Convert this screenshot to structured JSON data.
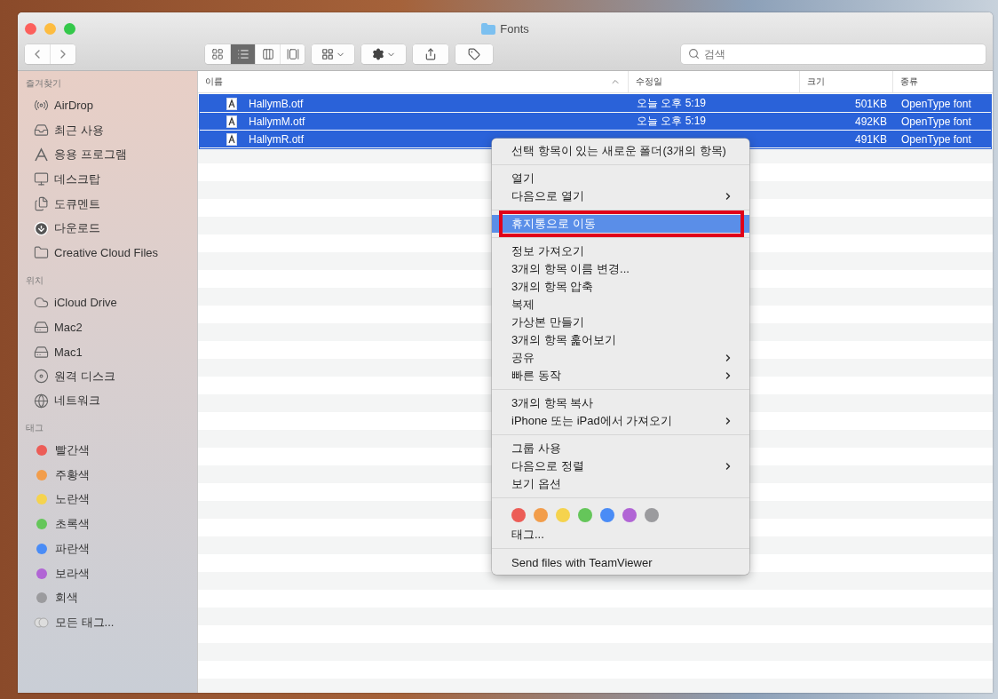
{
  "window": {
    "title": "Fonts"
  },
  "toolbar": {
    "view_buttons": [
      {
        "kind": "icons",
        "selected": false
      },
      {
        "kind": "list",
        "selected": true
      },
      {
        "kind": "columns",
        "selected": false
      },
      {
        "kind": "gallery",
        "selected": false
      }
    ]
  },
  "search": {
    "placeholder": "검색"
  },
  "sidebar": {
    "sections": [
      {
        "title": "즐겨찾기",
        "items": [
          {
            "label": "AirDrop",
            "kind": "airdrop"
          },
          {
            "label": "최근 사용",
            "kind": "recent"
          },
          {
            "label": "응용 프로그램",
            "kind": "apps"
          },
          {
            "label": "데스크탑",
            "kind": "desktop"
          },
          {
            "label": "도큐멘트",
            "kind": "documents"
          },
          {
            "label": "다운로드",
            "kind": "downloads"
          },
          {
            "label": "Creative Cloud Files",
            "kind": "folder"
          }
        ]
      },
      {
        "title": "위치",
        "items": [
          {
            "label": "iCloud Drive",
            "kind": "cloud"
          },
          {
            "label": "Mac2",
            "kind": "disk"
          },
          {
            "label": "Mac1",
            "kind": "disk"
          },
          {
            "label": "원격 디스크",
            "kind": "remote"
          },
          {
            "label": "네트워크",
            "kind": "network"
          }
        ]
      },
      {
        "title": "태그",
        "items": [
          {
            "label": "빨간색",
            "kind": "tag",
            "color": "#ec5d57"
          },
          {
            "label": "주황색",
            "kind": "tag",
            "color": "#f29d4b"
          },
          {
            "label": "노란색",
            "kind": "tag",
            "color": "#f5d34e"
          },
          {
            "label": "초록색",
            "kind": "tag",
            "color": "#65c65a"
          },
          {
            "label": "파란색",
            "kind": "tag",
            "color": "#4a8cf6"
          },
          {
            "label": "보라색",
            "kind": "tag",
            "color": "#b165d5"
          },
          {
            "label": "회색",
            "kind": "tag",
            "color": "#9b9b9e"
          },
          {
            "label": "모든 태그...",
            "kind": "all-tags"
          }
        ]
      }
    ]
  },
  "table": {
    "columns": [
      {
        "label": "이름",
        "sorted": true
      },
      {
        "label": "수정일",
        "sorted": false
      },
      {
        "label": "크기",
        "sorted": false
      },
      {
        "label": "종류",
        "sorted": false
      }
    ],
    "rows": [
      {
        "name": "HallymB.otf",
        "modified": "오늘 오후 5:19",
        "size": "501KB",
        "kind": "OpenType font",
        "selected": true
      },
      {
        "name": "HallymM.otf",
        "modified": "오늘 오후 5:19",
        "size": "492KB",
        "kind": "OpenType font",
        "selected": true
      },
      {
        "name": "HallymR.otf",
        "size": "491KB",
        "kind": "OpenType font",
        "selected": true
      }
    ]
  },
  "context_menu": {
    "sections": [
      [
        {
          "kind": "item",
          "label": "선택 항목이 있는 새로운 폴더(3개의 항목)",
          "submenu": false,
          "selected": false
        }
      ],
      [
        {
          "kind": "item",
          "label": "열기",
          "submenu": false,
          "selected": false
        },
        {
          "kind": "item",
          "label": "다음으로 열기",
          "submenu": true,
          "selected": false
        }
      ],
      [
        {
          "kind": "item",
          "label": "휴지통으로 이동",
          "submenu": false,
          "selected": true,
          "annotated": true
        }
      ],
      [
        {
          "kind": "item",
          "label": "정보 가져오기",
          "submenu": false,
          "selected": false
        },
        {
          "kind": "item",
          "label": "3개의 항목 이름 변경...",
          "submenu": false,
          "selected": false
        },
        {
          "kind": "item",
          "label": "3개의 항목 압축",
          "submenu": false,
          "selected": false
        },
        {
          "kind": "item",
          "label": "복제",
          "submenu": false,
          "selected": false
        },
        {
          "kind": "item",
          "label": "가상본 만들기",
          "submenu": false,
          "selected": false
        },
        {
          "kind": "item",
          "label": "3개의 항목 훑어보기",
          "submenu": false,
          "selected": false
        },
        {
          "kind": "item",
          "label": "공유",
          "submenu": true,
          "selected": false
        },
        {
          "kind": "item",
          "label": "빠른 동작",
          "submenu": true,
          "selected": false
        }
      ],
      [
        {
          "kind": "item",
          "label": "3개의 항목 복사",
          "submenu": false,
          "selected": false
        },
        {
          "kind": "item",
          "label": "iPhone 또는 iPad에서 가져오기",
          "submenu": true,
          "selected": false
        }
      ],
      [
        {
          "kind": "item",
          "label": "그룹 사용",
          "submenu": false,
          "selected": false
        },
        {
          "kind": "item",
          "label": "다음으로 정렬",
          "submenu": true,
          "selected": false
        },
        {
          "kind": "item",
          "label": "보기 옵션",
          "submenu": false,
          "selected": false
        }
      ],
      [
        {
          "kind": "tags",
          "colors": [
            {
              "color": "#ec5d57"
            },
            {
              "color": "#f29d4b"
            },
            {
              "color": "#f5d34e"
            },
            {
              "color": "#65c65a"
            },
            {
              "color": "#4a8cf6"
            },
            {
              "color": "#b165d5"
            },
            {
              "color": "#9b9b9e"
            }
          ]
        },
        {
          "kind": "item",
          "label": "태그...",
          "submenu": false,
          "selected": false
        }
      ],
      [
        {
          "kind": "item",
          "label": "Send files with TeamViewer",
          "submenu": false,
          "selected": false
        }
      ]
    ]
  }
}
